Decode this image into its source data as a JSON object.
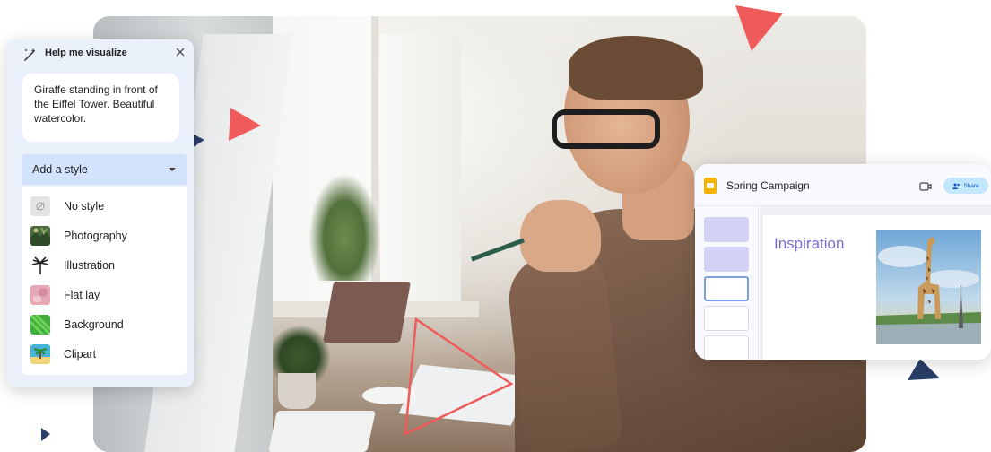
{
  "visualize_panel": {
    "title": "Help me visualize",
    "prompt_text": "Giraffe standing in front of the Eiffel Tower. Beautiful watercolor.",
    "style_dropdown_label": "Add a style",
    "style_options": [
      {
        "label": "No style",
        "icon": "no-style-icon"
      },
      {
        "label": "Photography",
        "icon": "photography-thumb"
      },
      {
        "label": "Illustration",
        "icon": "illustration-thumb"
      },
      {
        "label": "Flat lay",
        "icon": "flat-lay-thumb"
      },
      {
        "label": "Background",
        "icon": "background-thumb"
      },
      {
        "label": "Clipart",
        "icon": "clipart-thumb"
      }
    ]
  },
  "slides_window": {
    "title": "Spring Campaign",
    "share_label": "Share",
    "slide_heading": "Inspiration"
  },
  "colors": {
    "accent_red": "#ef5b5b",
    "accent_navy": "#2a3d66",
    "panel_bg": "#eaf1fb",
    "dropdown_bg": "#d3e3fd",
    "share_bg": "#c2e7ff",
    "heading_purple": "#7b6fd4"
  }
}
